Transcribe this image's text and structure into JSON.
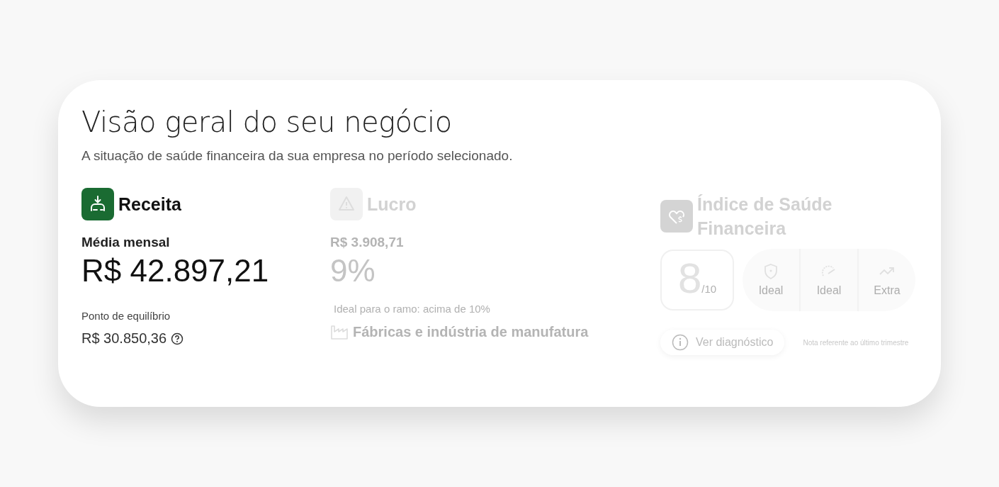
{
  "title": "Visão geral do seu negócio",
  "subtitle": "A situação de saúde financeira da sua empresa no período selecionado.",
  "revenue": {
    "title": "Receita",
    "dimmed": false,
    "label": "Média mensal",
    "value": "R$ 42.897,21",
    "breakeven_label": "Ponto de equilíbrio",
    "breakeven_value": "R$ 30.850,36"
  },
  "profit": {
    "title": "Lucro",
    "dimmed": true,
    "value": "R$ 3.908,71",
    "percent": "9%",
    "ideal": "Ideal para o ramo: acima de 10%",
    "industry": "Fábricas e indústria de manufatura"
  },
  "health": {
    "title": "Índice de Saúde Financeira",
    "dimmed": true,
    "score": "8",
    "score_max": "/10",
    "indicators": [
      {
        "kind": "shield",
        "label": "Ideal"
      },
      {
        "kind": "gauge",
        "label": "Ideal"
      },
      {
        "kind": "trend",
        "label": "Extra"
      }
    ],
    "button": "Ver diagnóstico",
    "note": "Nota referente ao último trimestre"
  }
}
